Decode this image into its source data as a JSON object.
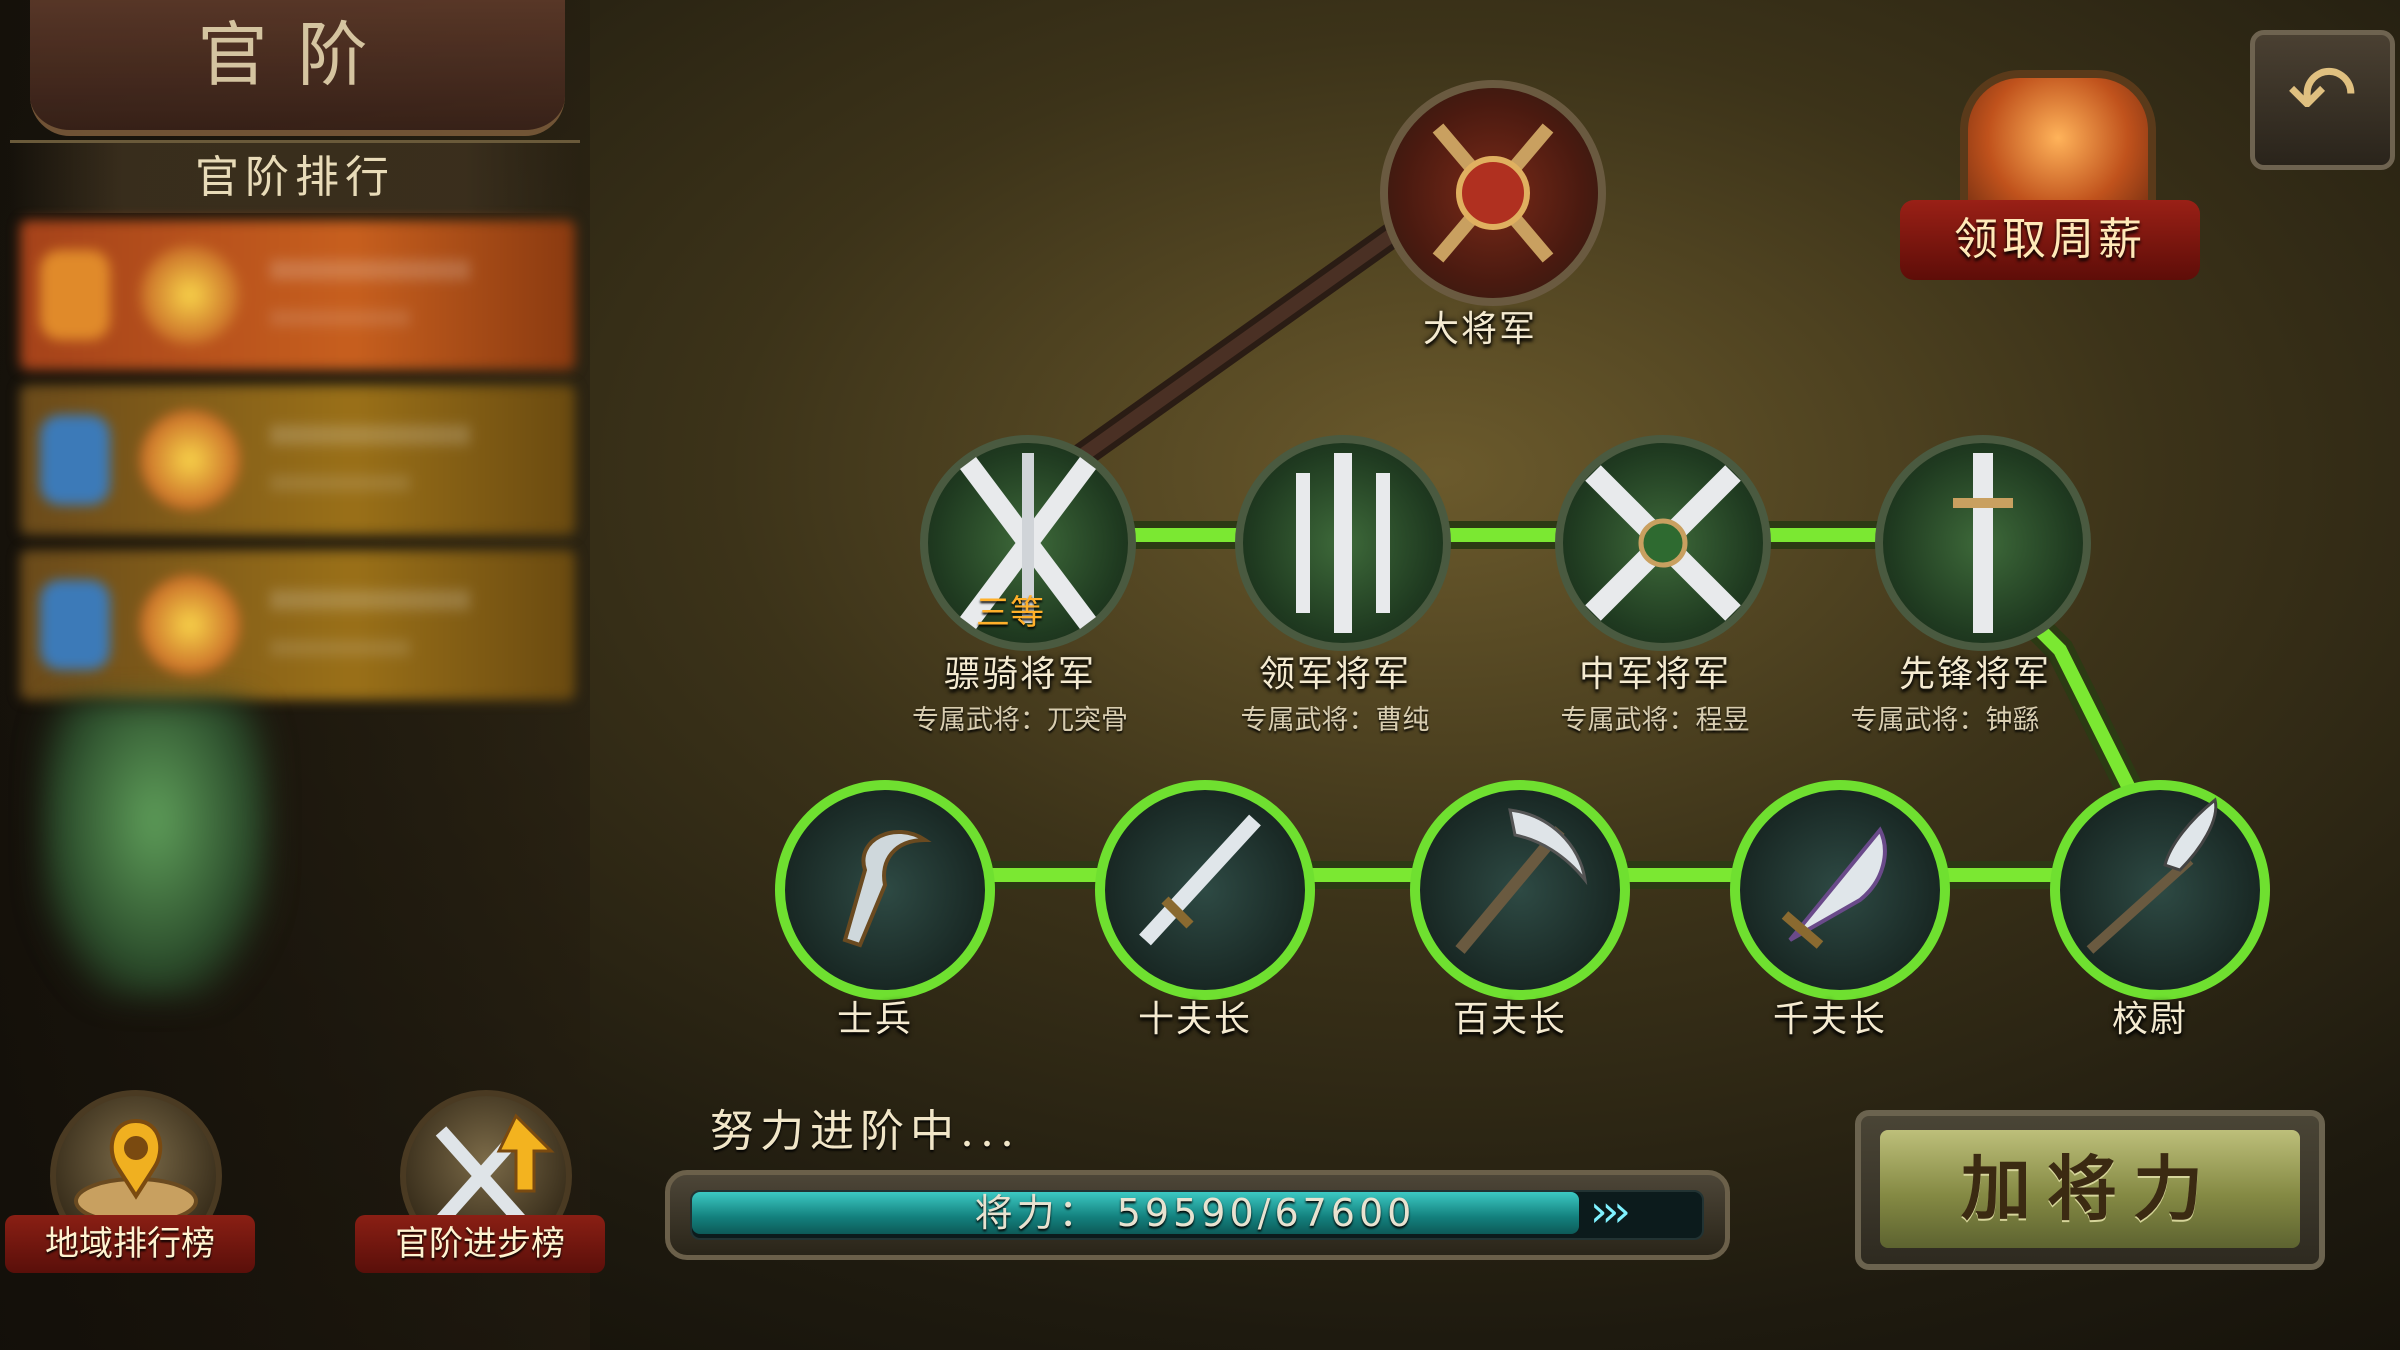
{
  "title_plaque": "官阶",
  "left_panel": {
    "rank_header": "官阶排行",
    "rows": [
      {
        "color": "#b5531c"
      },
      {
        "color": "#8a6a1c"
      },
      {
        "color": "#8a6a1c"
      }
    ]
  },
  "bottom_buttons": {
    "regional_ranking": "地域排行榜",
    "rank_progress_ranking": "官阶进步榜"
  },
  "weekly_chest_label": "领取周薪",
  "back_icon": "back-arrow-icon",
  "tree": {
    "top_rank": {
      "name": "大将军",
      "icon": "axe-emblem-icon"
    },
    "upper_rank": [
      {
        "name": "骠骑将军",
        "hero": "专属武将：兀突骨",
        "grade": "三等",
        "icon": "crossed-swords-icon"
      },
      {
        "name": "领军将军",
        "hero": "专属武将：曹纯",
        "icon": "triple-swords-icon"
      },
      {
        "name": "中军将军",
        "hero": "专属武将：程昱",
        "icon": "crossed-blades-icon"
      },
      {
        "name": "先锋将军",
        "hero": "专属武将：钟繇",
        "icon": "single-sword-icon"
      }
    ],
    "lower_rank": [
      {
        "name": "士兵",
        "icon": "sickle-icon"
      },
      {
        "name": "十夫长",
        "icon": "dagger-icon"
      },
      {
        "name": "百夫长",
        "icon": "pick-axe-icon"
      },
      {
        "name": "千夫长",
        "icon": "saber-icon"
      },
      {
        "name": "校尉",
        "icon": "glaive-icon"
      }
    ]
  },
  "progress": {
    "caption": "努力进阶中...",
    "text": "将力： 59590/67600",
    "current": 59590,
    "max": 67600,
    "arrows": "›››"
  },
  "add_power_button": "加将力",
  "colors": {
    "path_green": "#6be02a",
    "accent_gold": "#d9b36a",
    "banner_red": "#8a1f14"
  }
}
